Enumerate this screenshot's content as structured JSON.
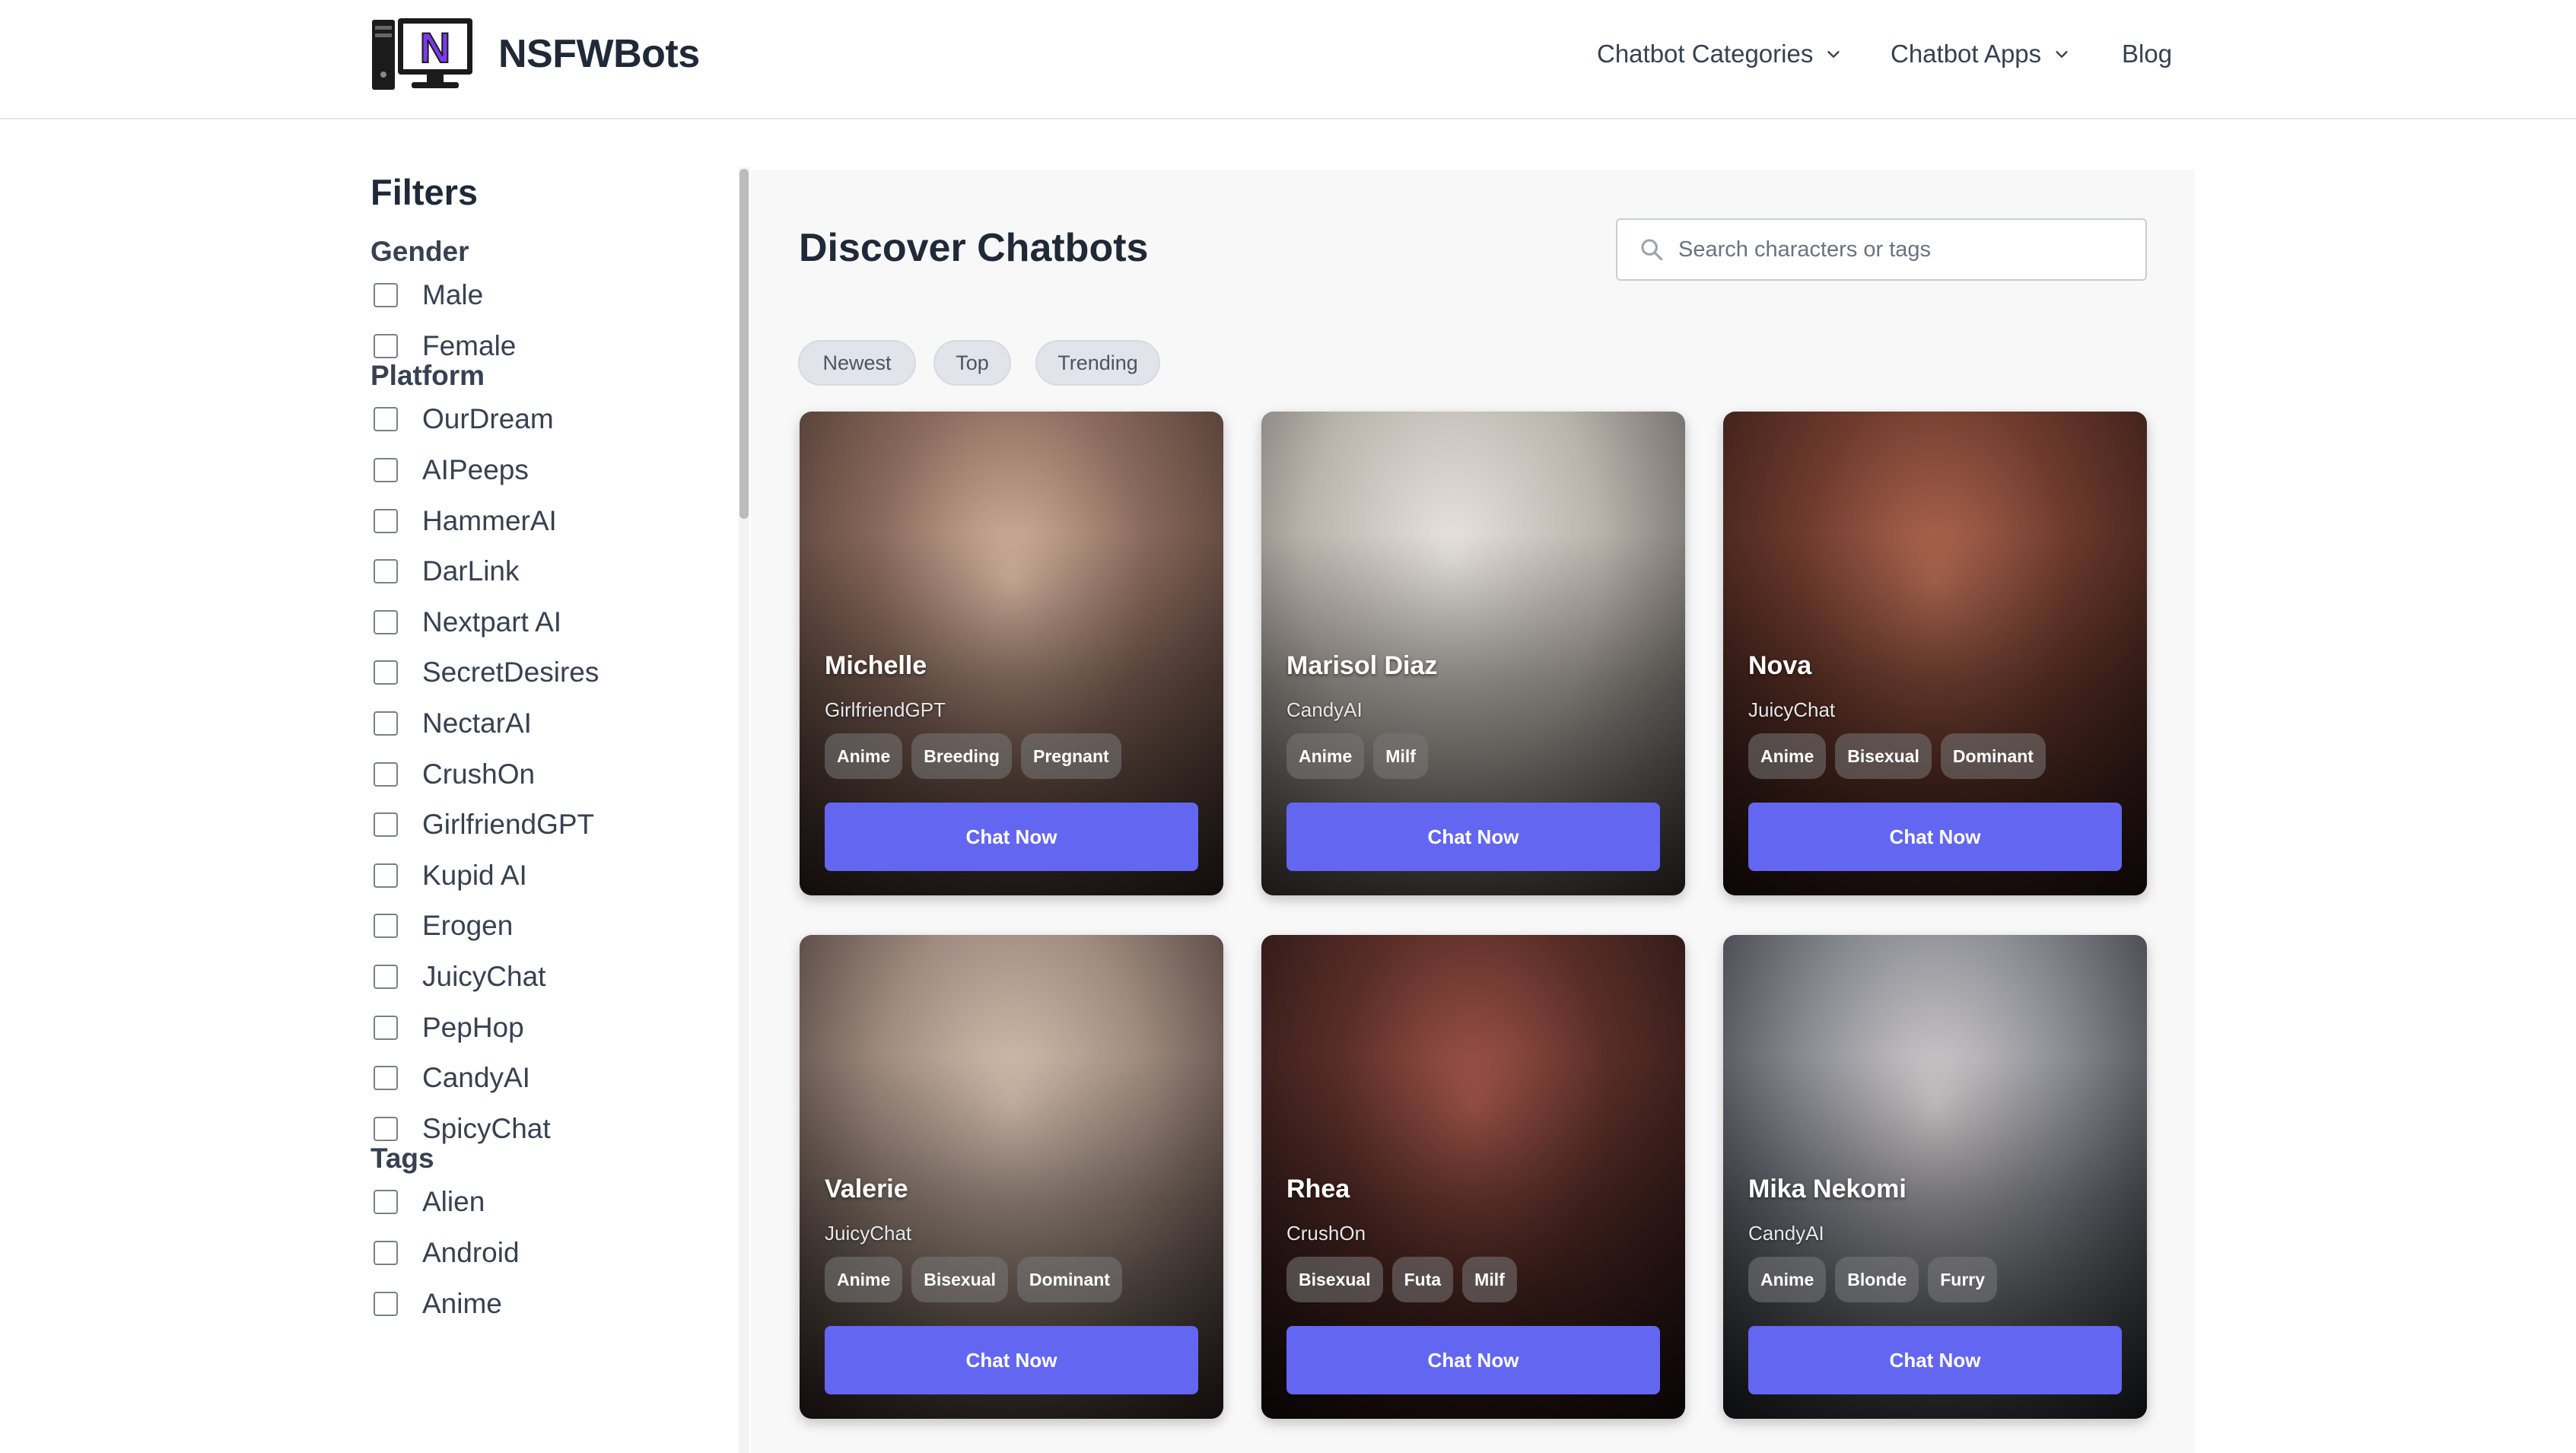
{
  "header": {
    "brand": "NSFWBots",
    "nav": [
      {
        "label": "Chatbot Categories",
        "icon": "chevron-down-icon"
      },
      {
        "label": "Chatbot Apps",
        "icon": "chevron-down-icon"
      },
      {
        "label": "Blog"
      }
    ]
  },
  "sidebar": {
    "title": "Filters",
    "groups": [
      {
        "title": "Gender",
        "options": [
          "Male",
          "Female"
        ]
      },
      {
        "title": "Platform",
        "options": [
          "OurDream",
          "AIPeeps",
          "HammerAI",
          "DarLink",
          "Nextpart AI",
          "SecretDesires",
          "NectarAI",
          "CrushOn",
          "GirlfriendGPT",
          "Kupid AI",
          "Erogen",
          "JuicyChat",
          "PepHop",
          "CandyAI",
          "SpicyChat"
        ]
      },
      {
        "title": "Tags",
        "options": [
          "Alien",
          "Android",
          "Anime"
        ]
      }
    ]
  },
  "main": {
    "title": "Discover Chatbots",
    "search_placeholder": "Search characters or tags",
    "sort_tabs": [
      "Newest",
      "Top",
      "Trending"
    ],
    "button_label": "Chat Now",
    "cards": [
      {
        "name": "Michelle",
        "platform": "GirlfriendGPT",
        "tags": [
          "Anime",
          "Breeding",
          "Pregnant"
        ]
      },
      {
        "name": "Marisol Diaz",
        "platform": "CandyAI",
        "tags": [
          "Anime",
          "Milf"
        ]
      },
      {
        "name": "Nova",
        "platform": "JuicyChat",
        "tags": [
          "Anime",
          "Bisexual",
          "Dominant"
        ]
      },
      {
        "name": "Valerie",
        "platform": "JuicyChat",
        "tags": [
          "Anime",
          "Bisexual",
          "Dominant"
        ]
      },
      {
        "name": "Rhea",
        "platform": "CrushOn",
        "tags": [
          "Bisexual",
          "Futa",
          "Milf"
        ]
      },
      {
        "name": "Mika Nekomi",
        "platform": "CandyAI",
        "tags": [
          "Anime",
          "Blonde",
          "Furry"
        ]
      }
    ]
  },
  "colors": {
    "accent": "#6366f1",
    "card_backgrounds": [
      "#8a6a5c",
      "#b9b3ab",
      "#6e3a2d",
      "#9e8a7e",
      "#5a2e28",
      "#8a8c93"
    ]
  }
}
